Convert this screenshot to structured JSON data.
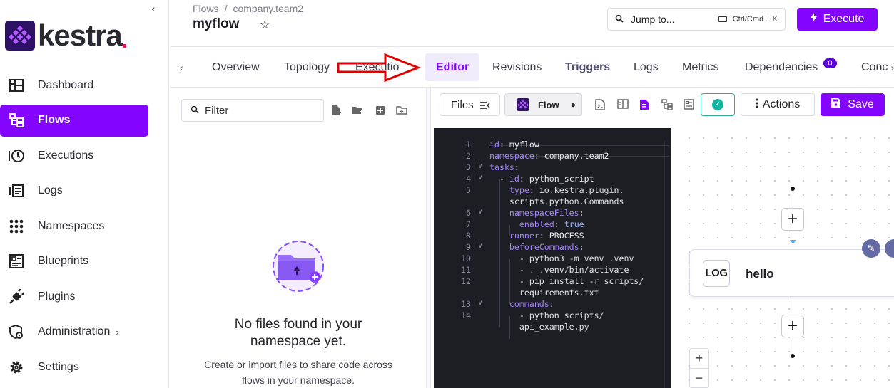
{
  "sidebar": {
    "collapse_glyph": "‹",
    "logo_text": "kestra",
    "items": [
      {
        "label": "Dashboard",
        "icon": "dashboard-icon"
      },
      {
        "label": "Flows",
        "icon": "flows-icon",
        "active": true
      },
      {
        "label": "Executions",
        "icon": "executions-icon"
      },
      {
        "label": "Logs",
        "icon": "logs-icon"
      },
      {
        "label": "Namespaces",
        "icon": "namespaces-icon"
      },
      {
        "label": "Blueprints",
        "icon": "blueprints-icon"
      },
      {
        "label": "Plugins",
        "icon": "plugins-icon"
      },
      {
        "label": "Administration",
        "icon": "administration-icon",
        "chevron": "›"
      },
      {
        "label": "Settings",
        "icon": "settings-icon"
      }
    ]
  },
  "header": {
    "breadcrumb": [
      "Flows",
      "company.team2"
    ],
    "breadcrumb_sep": "/",
    "title": "myflow",
    "jump_label": "Jump to...",
    "jump_shortcut": "Ctrl/Cmd + K",
    "execute_label": "Execute"
  },
  "tabs": {
    "items": [
      "Overview",
      "Topology",
      "Executions",
      "Editor",
      "Revisions",
      "Triggers",
      "Logs",
      "Metrics",
      "Dependencies",
      "Concurrency"
    ],
    "visible_labels": [
      "Overview",
      "Topology",
      "Executio",
      "Editor",
      "Revisions",
      "Triggers",
      "Logs",
      "Metrics",
      "Dependencies",
      "Conc"
    ],
    "active": "Editor",
    "dependencies_badge": "0"
  },
  "files_panel": {
    "filter_placeholder": "Filter",
    "empty_title": "No files found in your namespace yet.",
    "empty_desc": "Create or import files to share code across flows in your namespace."
  },
  "editor_toolbar": {
    "files_label": "Files",
    "flow_label": "Flow",
    "flow_dirty_marker": "●",
    "actions_label": "Actions",
    "save_label": "Save"
  },
  "code_lines": [
    {
      "n": "1",
      "fold": "",
      "text": "id: myflow"
    },
    {
      "n": "2",
      "fold": "",
      "text": "namespace: company.team2"
    },
    {
      "n": "3",
      "fold": "∨",
      "text": "tasks:"
    },
    {
      "n": "4",
      "fold": "∨",
      "text": "  - id: python_script"
    },
    {
      "n": "5",
      "fold": "",
      "text": "    type: io.kestra.plugin."
    },
    {
      "n": "",
      "fold": "",
      "text": "    scripts.python.Commands"
    },
    {
      "n": "6",
      "fold": "∨",
      "text": "    namespaceFiles:"
    },
    {
      "n": "7",
      "fold": "",
      "text": "      enabled: true"
    },
    {
      "n": "8",
      "fold": "",
      "text": "    runner: PROCESS"
    },
    {
      "n": "9",
      "fold": "∨",
      "text": "    beforeCommands:"
    },
    {
      "n": "10",
      "fold": "",
      "text": "      - python3 -m venv .venv"
    },
    {
      "n": "11",
      "fold": "",
      "text": "      - . .venv/bin/activate"
    },
    {
      "n": "12",
      "fold": "",
      "text": "      - pip install -r scripts/"
    },
    {
      "n": "",
      "fold": "",
      "text": "      requirements.txt"
    },
    {
      "n": "13",
      "fold": "∨",
      "text": "    commands:"
    },
    {
      "n": "14",
      "fold": "",
      "text": "      - python scripts/"
    },
    {
      "n": "",
      "fold": "",
      "text": "      api_example.py"
    }
  ],
  "topology": {
    "task_type_label": "LOG",
    "task_name": "hello",
    "add_glyph": "+",
    "zoom_in": "+",
    "zoom_out": "−"
  },
  "colors": {
    "accent": "#8405ff",
    "validation": "#11b6a2",
    "annotation_arrow": "#e00000"
  }
}
